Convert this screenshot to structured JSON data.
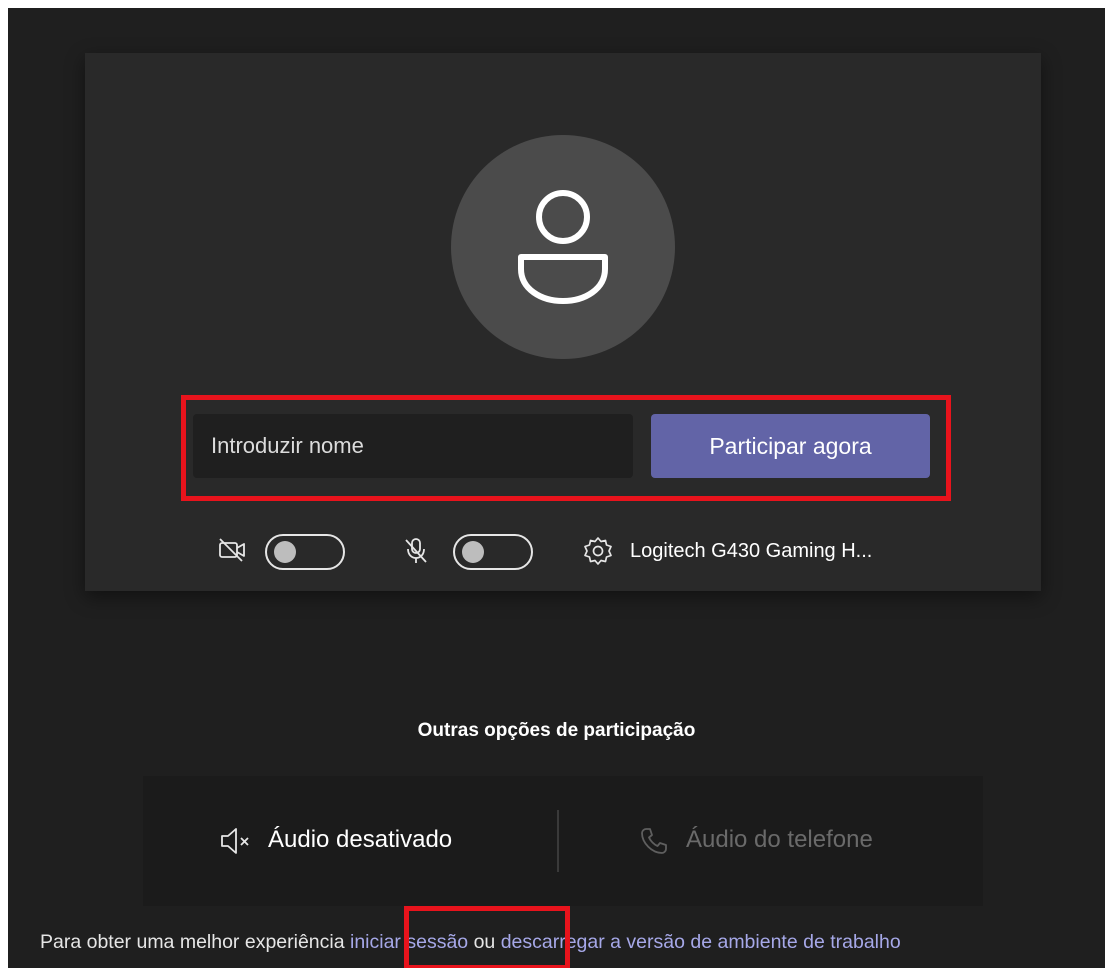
{
  "join": {
    "name_placeholder": "Introduzir nome",
    "join_button_label": "Participar agora"
  },
  "devices": {
    "camera": {
      "icon": "camera-off-icon",
      "enabled": false
    },
    "microphone": {
      "icon": "mic-off-icon",
      "enabled": false
    },
    "settings_icon": "gear-icon",
    "audio_device_label": "Logitech G430 Gaming H..."
  },
  "other_options": {
    "title": "Outras opções de participação",
    "audio_off": {
      "icon": "speaker-muted-icon",
      "label": "Áudio desativado"
    },
    "phone_audio": {
      "icon": "phone-icon",
      "label": "Áudio do telefone"
    }
  },
  "footer": {
    "prefix": "Para obter uma melhor experiência",
    "sign_in_link": "iniciar sessão",
    "separator": "ou",
    "download_link": "descarregar a versão de ambiente de trabalho"
  },
  "colors": {
    "background": "#1f1f1f",
    "card": "#292929",
    "avatar": "#4b4b4b",
    "accent": "#6264a7",
    "link": "#a6a8e8",
    "highlight": "#e8131c"
  }
}
